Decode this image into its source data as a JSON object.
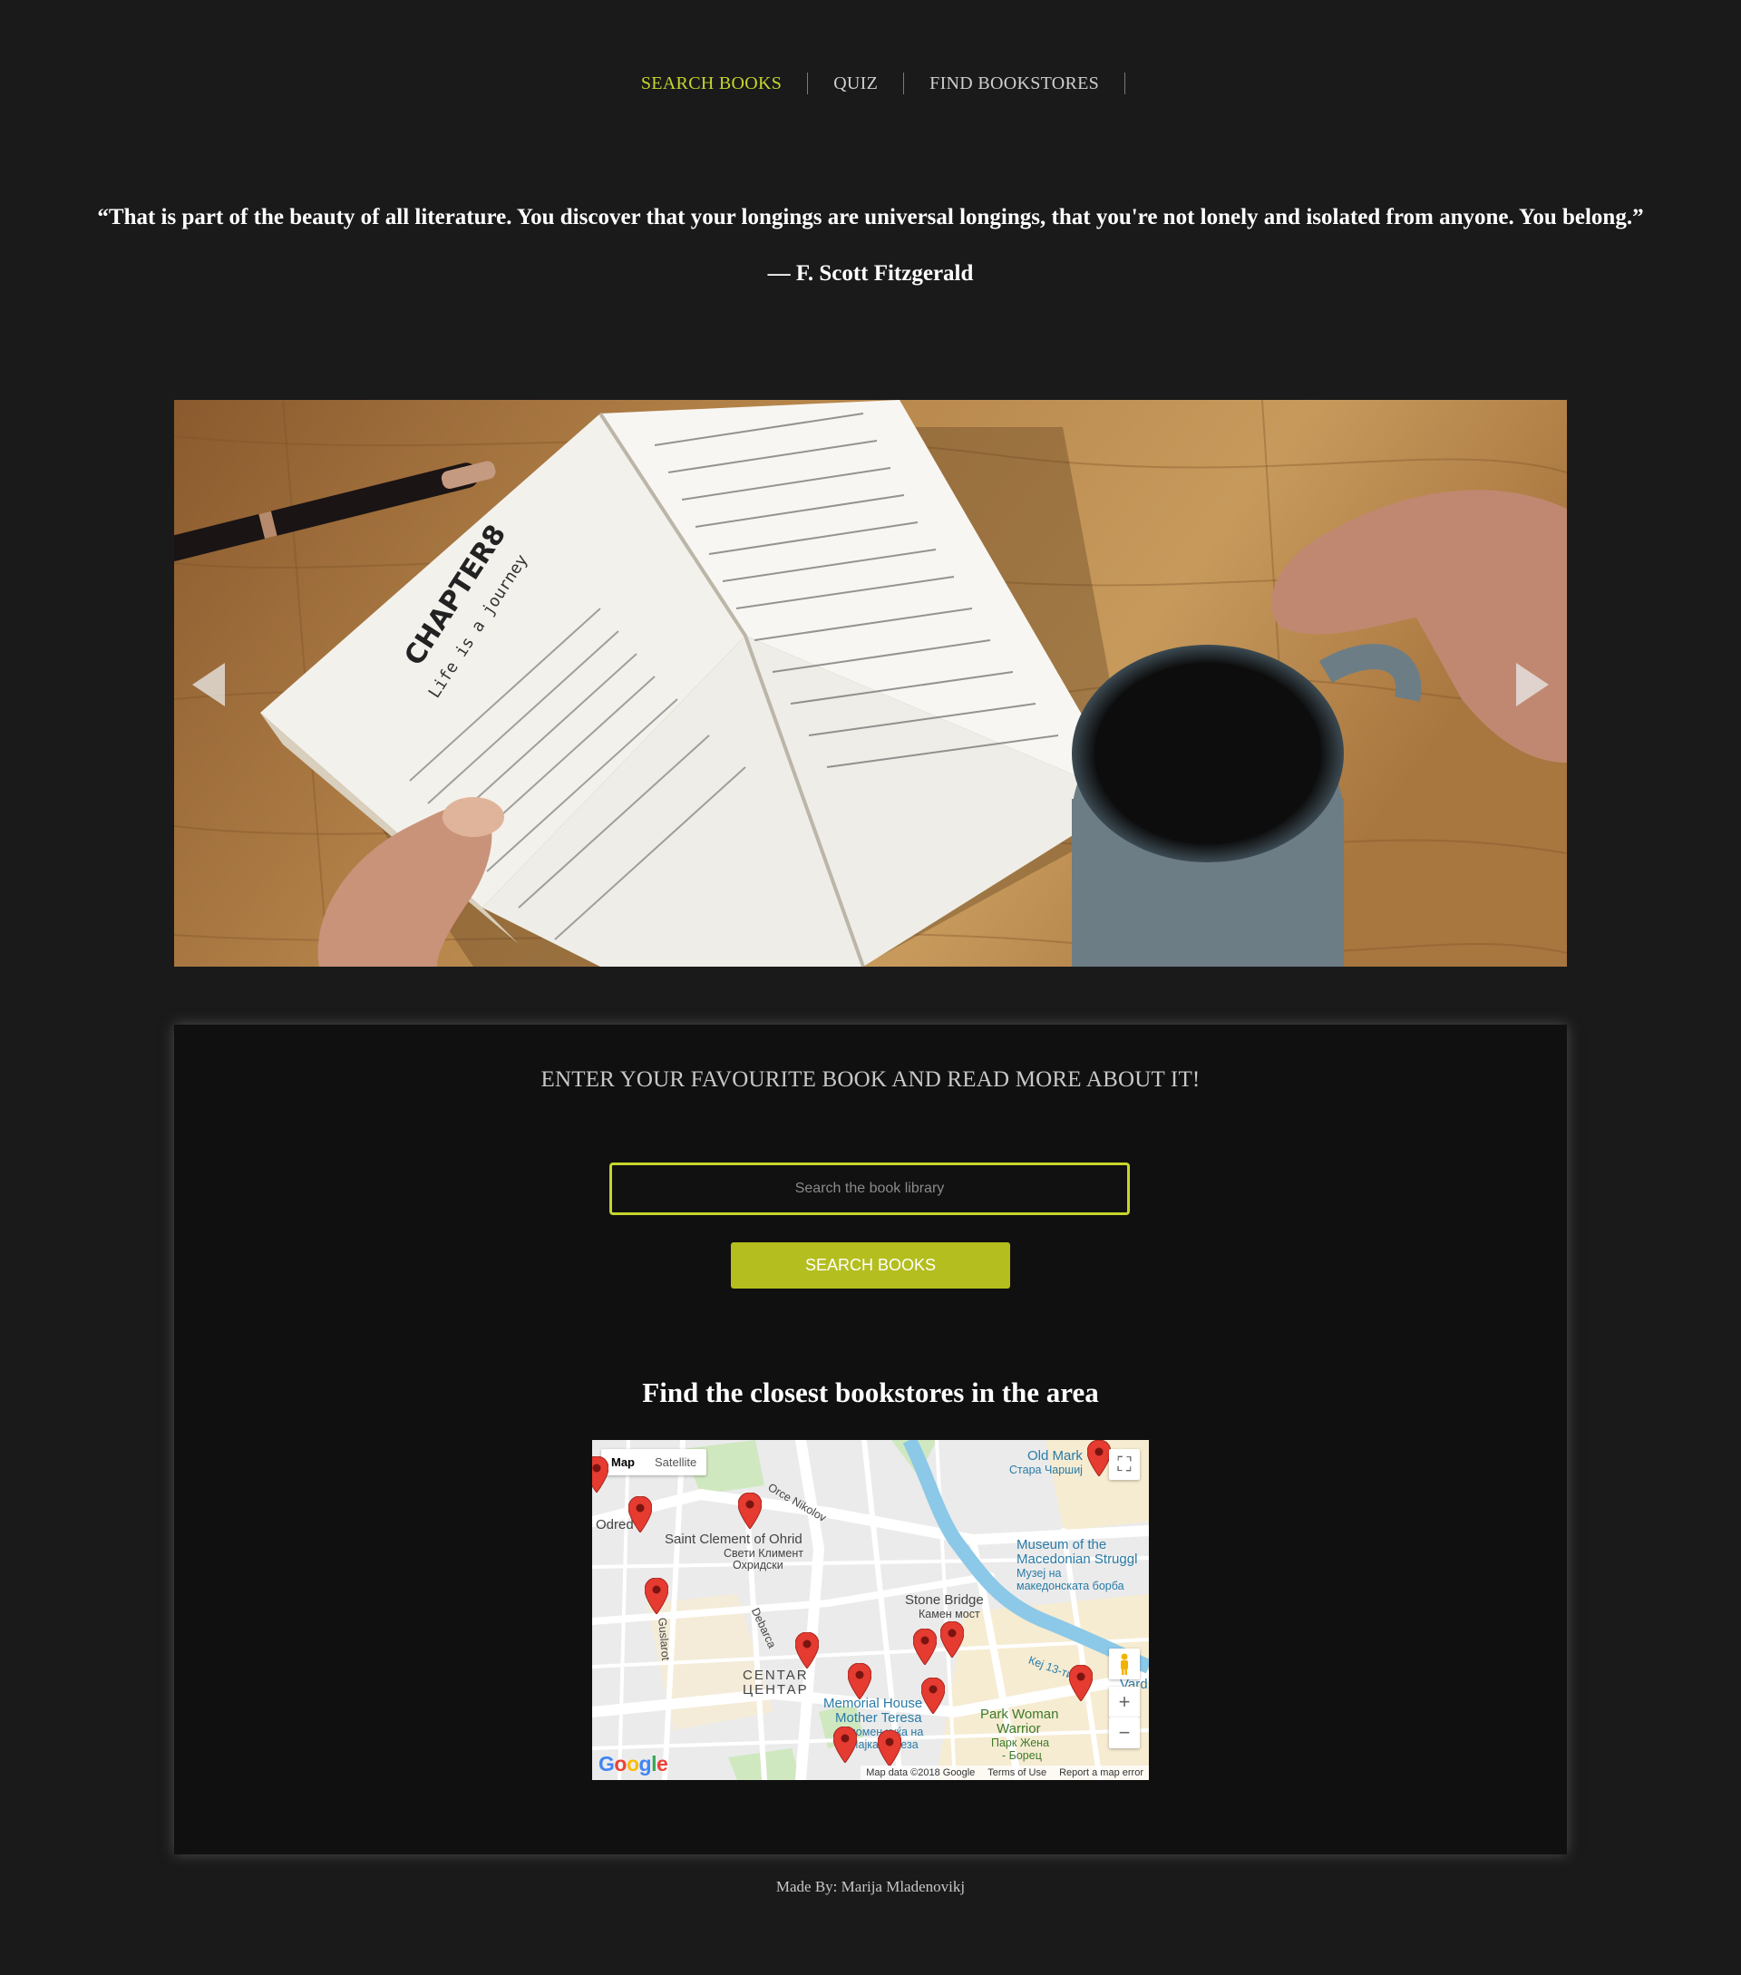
{
  "nav": {
    "items": [
      {
        "label": "SEARCH BOOKS",
        "active": true
      },
      {
        "label": "QUIZ",
        "active": false
      },
      {
        "label": "FIND BOOKSTORES",
        "active": false
      }
    ]
  },
  "quote": {
    "text": "“That is part of the beauty of all literature. You discover that your longings are universal longings, that you're not lonely and isolated from anyone. You belong.”",
    "author": "— F. Scott Fitzgerald"
  },
  "carousel": {
    "chapter_title": "CHAPTER8",
    "chapter_subtitle": "Life is a journey"
  },
  "search": {
    "heading": "ENTER YOUR FAVOURITE BOOK AND READ MORE ABOUT IT!",
    "placeholder": "Search the book library",
    "button_label": "SEARCH BOOKS"
  },
  "map": {
    "heading": "Find the closest bookstores in the area",
    "type_map": "Map",
    "type_satellite": "Satellite",
    "labels": {
      "odred": "Odred",
      "orce": "Orce Nikolov",
      "saint_clement": "Saint Clement of Ohrid",
      "saint_clement_mk1": "Свети Климент",
      "saint_clement_mk2": "Охридски",
      "old_market": "Old Mark",
      "old_market_mk": "Стара Чаршиј",
      "museum1": "Museum of the",
      "museum2": "Macedonian Struggl",
      "museum_mk1": "Музеј на",
      "museum_mk2": "македонската борба",
      "stone_bridge": "Stone Bridge",
      "stone_bridge_mk": "Камен мост",
      "centar": "CENTAR",
      "centar_mk": "ЦЕНТАР",
      "memorial1": "Memorial House",
      "memorial2": "Mother Teresa",
      "memorial_mk1": "Спомен куќа на",
      "memorial_mk2": "Мајка Тереза",
      "park1": "Park Woman",
      "park2": "Warrior",
      "park_mk1": "Парк Жена",
      "park_mk2": "- Борец",
      "debarca": "Debarca",
      "guslarot": "Guslarot",
      "vardar": "Vard",
      "kej": "Кеј 13-ти"
    },
    "footer": {
      "data": "Map data ©2018 Google",
      "terms": "Terms of Use",
      "report": "Report a map error"
    },
    "logo": "Google",
    "pin_color": "#e53b30"
  },
  "footer": {
    "credit": "Made By: Marija Mladenovikj"
  }
}
